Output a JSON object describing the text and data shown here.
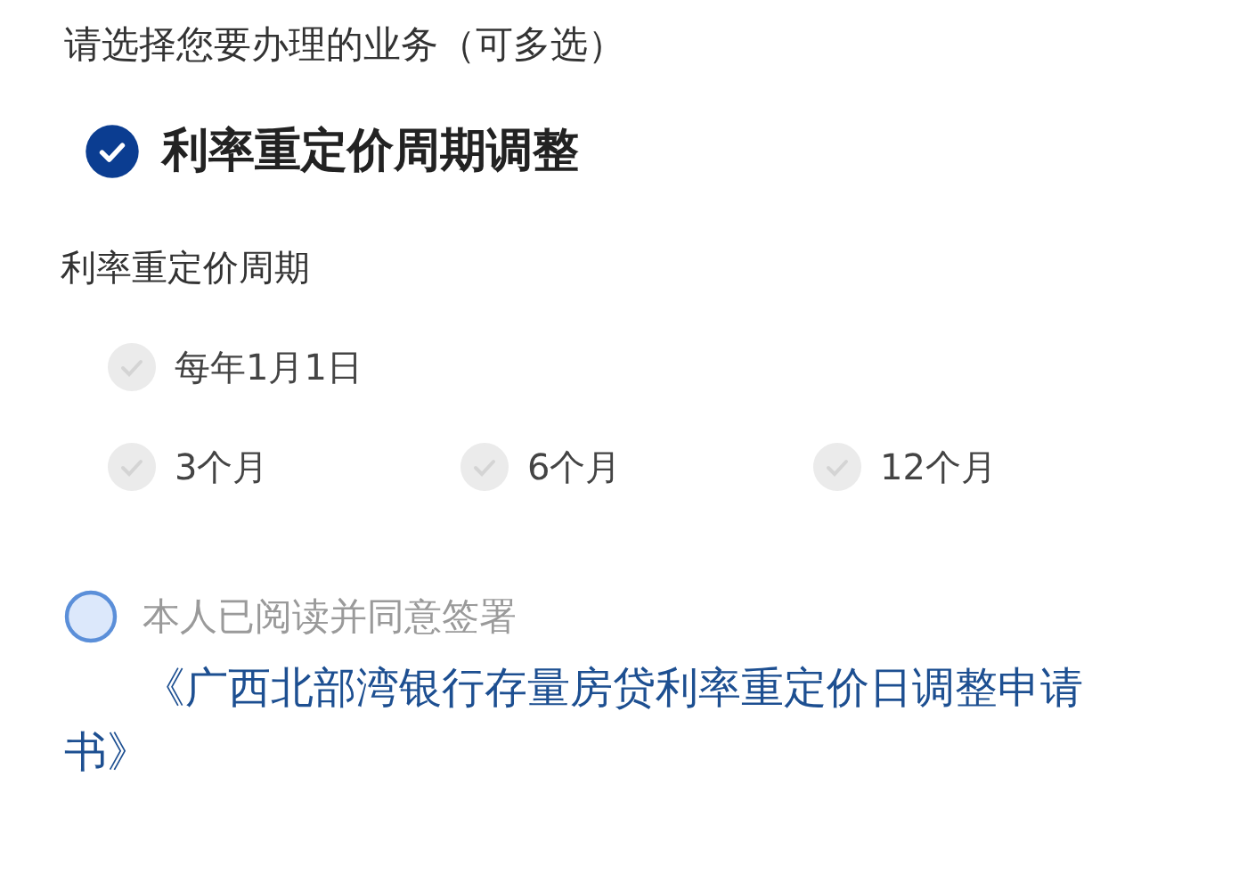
{
  "title": "请选择您要办理的业务（可多选）",
  "service": {
    "label": "利率重定价周期调整",
    "checked": true
  },
  "period": {
    "label": "利率重定价周期",
    "options": [
      {
        "label": "每年1月1日",
        "selected": false,
        "disabled": true
      },
      {
        "label": "3个月",
        "selected": false,
        "disabled": true
      },
      {
        "label": "6个月",
        "selected": false,
        "disabled": true
      },
      {
        "label": "12个月",
        "selected": false,
        "disabled": true
      }
    ]
  },
  "agreement": {
    "checked": false,
    "text": "本人已阅读并同意签署",
    "link": "《广西北部湾银行存量房贷利率重定价日调整申请书》"
  }
}
